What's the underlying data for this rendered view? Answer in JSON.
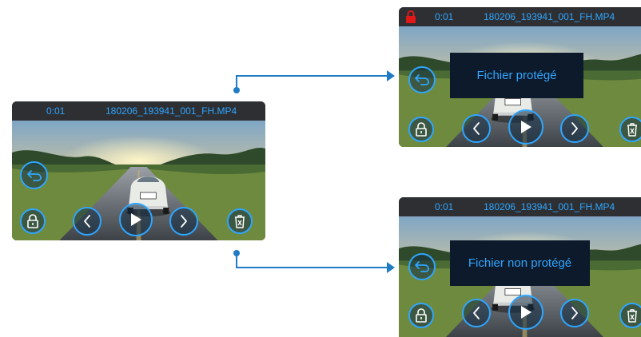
{
  "accent_color": "#2fa6ff",
  "lock_color": "#e01818",
  "screens": {
    "left": {
      "time": "0:01",
      "filename": "180206_193941_001_FH.MP4"
    },
    "top_right": {
      "time": "0:01",
      "filename": "180206_193941_001_FH.MP4",
      "message": "Fichier protégé",
      "lock_icon": "padlock-icon"
    },
    "bottom_right": {
      "time": "0:01",
      "filename": "180206_193941_001_FH.MP4",
      "message": "Fichier non protégé"
    }
  },
  "icons": {
    "back": "back-arrow-icon",
    "lock": "lock-icon",
    "previous": "chevron-left-icon",
    "play": "play-icon",
    "next": "chevron-right-icon",
    "delete": "trash-icon"
  }
}
